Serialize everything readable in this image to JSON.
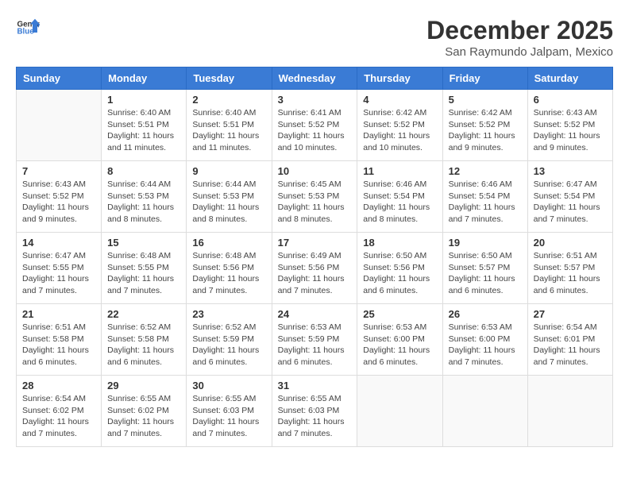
{
  "header": {
    "logo_general": "General",
    "logo_blue": "Blue",
    "month": "December 2025",
    "location": "San Raymundo Jalpam, Mexico"
  },
  "days_of_week": [
    "Sunday",
    "Monday",
    "Tuesday",
    "Wednesday",
    "Thursday",
    "Friday",
    "Saturday"
  ],
  "weeks": [
    [
      {
        "day": "",
        "info": ""
      },
      {
        "day": "1",
        "info": "Sunrise: 6:40 AM\nSunset: 5:51 PM\nDaylight: 11 hours and 11 minutes."
      },
      {
        "day": "2",
        "info": "Sunrise: 6:40 AM\nSunset: 5:51 PM\nDaylight: 11 hours and 11 minutes."
      },
      {
        "day": "3",
        "info": "Sunrise: 6:41 AM\nSunset: 5:52 PM\nDaylight: 11 hours and 10 minutes."
      },
      {
        "day": "4",
        "info": "Sunrise: 6:42 AM\nSunset: 5:52 PM\nDaylight: 11 hours and 10 minutes."
      },
      {
        "day": "5",
        "info": "Sunrise: 6:42 AM\nSunset: 5:52 PM\nDaylight: 11 hours and 9 minutes."
      },
      {
        "day": "6",
        "info": "Sunrise: 6:43 AM\nSunset: 5:52 PM\nDaylight: 11 hours and 9 minutes."
      }
    ],
    [
      {
        "day": "7",
        "info": "Sunrise: 6:43 AM\nSunset: 5:52 PM\nDaylight: 11 hours and 9 minutes."
      },
      {
        "day": "8",
        "info": "Sunrise: 6:44 AM\nSunset: 5:53 PM\nDaylight: 11 hours and 8 minutes."
      },
      {
        "day": "9",
        "info": "Sunrise: 6:44 AM\nSunset: 5:53 PM\nDaylight: 11 hours and 8 minutes."
      },
      {
        "day": "10",
        "info": "Sunrise: 6:45 AM\nSunset: 5:53 PM\nDaylight: 11 hours and 8 minutes."
      },
      {
        "day": "11",
        "info": "Sunrise: 6:46 AM\nSunset: 5:54 PM\nDaylight: 11 hours and 8 minutes."
      },
      {
        "day": "12",
        "info": "Sunrise: 6:46 AM\nSunset: 5:54 PM\nDaylight: 11 hours and 7 minutes."
      },
      {
        "day": "13",
        "info": "Sunrise: 6:47 AM\nSunset: 5:54 PM\nDaylight: 11 hours and 7 minutes."
      }
    ],
    [
      {
        "day": "14",
        "info": "Sunrise: 6:47 AM\nSunset: 5:55 PM\nDaylight: 11 hours and 7 minutes."
      },
      {
        "day": "15",
        "info": "Sunrise: 6:48 AM\nSunset: 5:55 PM\nDaylight: 11 hours and 7 minutes."
      },
      {
        "day": "16",
        "info": "Sunrise: 6:48 AM\nSunset: 5:56 PM\nDaylight: 11 hours and 7 minutes."
      },
      {
        "day": "17",
        "info": "Sunrise: 6:49 AM\nSunset: 5:56 PM\nDaylight: 11 hours and 7 minutes."
      },
      {
        "day": "18",
        "info": "Sunrise: 6:50 AM\nSunset: 5:56 PM\nDaylight: 11 hours and 6 minutes."
      },
      {
        "day": "19",
        "info": "Sunrise: 6:50 AM\nSunset: 5:57 PM\nDaylight: 11 hours and 6 minutes."
      },
      {
        "day": "20",
        "info": "Sunrise: 6:51 AM\nSunset: 5:57 PM\nDaylight: 11 hours and 6 minutes."
      }
    ],
    [
      {
        "day": "21",
        "info": "Sunrise: 6:51 AM\nSunset: 5:58 PM\nDaylight: 11 hours and 6 minutes."
      },
      {
        "day": "22",
        "info": "Sunrise: 6:52 AM\nSunset: 5:58 PM\nDaylight: 11 hours and 6 minutes."
      },
      {
        "day": "23",
        "info": "Sunrise: 6:52 AM\nSunset: 5:59 PM\nDaylight: 11 hours and 6 minutes."
      },
      {
        "day": "24",
        "info": "Sunrise: 6:53 AM\nSunset: 5:59 PM\nDaylight: 11 hours and 6 minutes."
      },
      {
        "day": "25",
        "info": "Sunrise: 6:53 AM\nSunset: 6:00 PM\nDaylight: 11 hours and 6 minutes."
      },
      {
        "day": "26",
        "info": "Sunrise: 6:53 AM\nSunset: 6:00 PM\nDaylight: 11 hours and 7 minutes."
      },
      {
        "day": "27",
        "info": "Sunrise: 6:54 AM\nSunset: 6:01 PM\nDaylight: 11 hours and 7 minutes."
      }
    ],
    [
      {
        "day": "28",
        "info": "Sunrise: 6:54 AM\nSunset: 6:02 PM\nDaylight: 11 hours and 7 minutes."
      },
      {
        "day": "29",
        "info": "Sunrise: 6:55 AM\nSunset: 6:02 PM\nDaylight: 11 hours and 7 minutes."
      },
      {
        "day": "30",
        "info": "Sunrise: 6:55 AM\nSunset: 6:03 PM\nDaylight: 11 hours and 7 minutes."
      },
      {
        "day": "31",
        "info": "Sunrise: 6:55 AM\nSunset: 6:03 PM\nDaylight: 11 hours and 7 minutes."
      },
      {
        "day": "",
        "info": ""
      },
      {
        "day": "",
        "info": ""
      },
      {
        "day": "",
        "info": ""
      }
    ]
  ]
}
